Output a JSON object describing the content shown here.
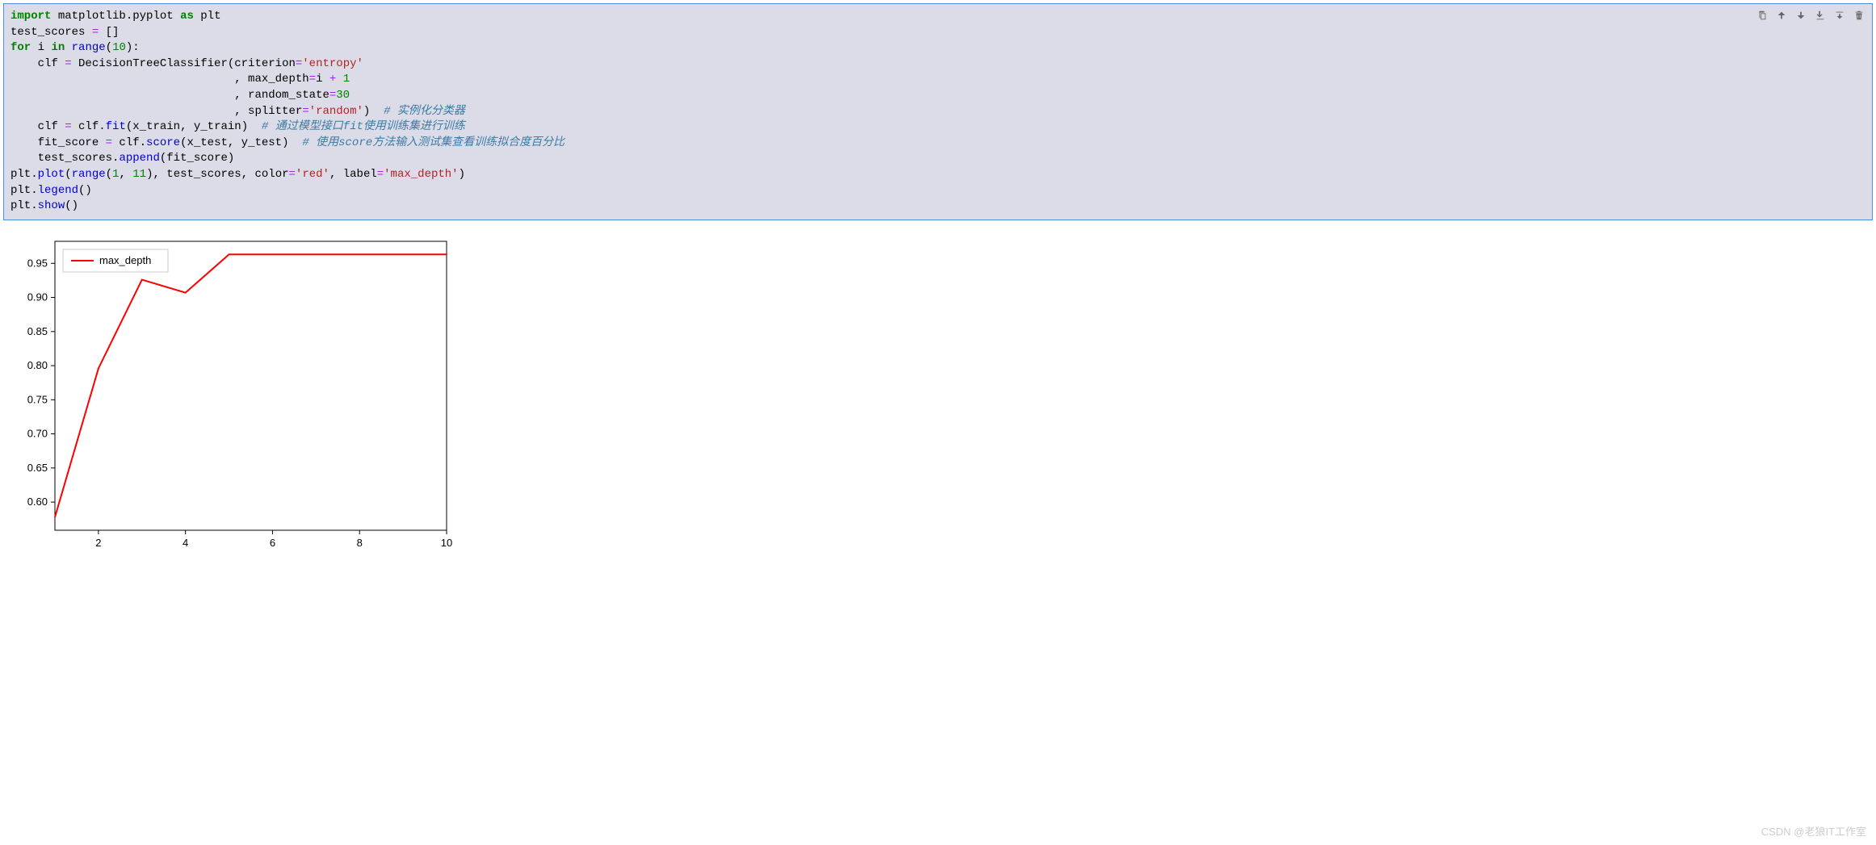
{
  "code_lines": [
    {
      "indent": 0,
      "tokens": [
        [
          "kw",
          "import"
        ],
        [
          "nm",
          " matplotlib.pyplot "
        ],
        [
          "kw",
          "as"
        ],
        [
          "nm",
          " plt"
        ]
      ]
    },
    {
      "indent": 0,
      "tokens": [
        [
          "nm",
          "test_scores "
        ],
        [
          "op",
          "="
        ],
        [
          "nm",
          " []"
        ]
      ]
    },
    {
      "indent": 0,
      "tokens": [
        [
          "kw",
          "for"
        ],
        [
          "nm",
          " i "
        ],
        [
          "kw",
          "in"
        ],
        [
          "nm",
          " "
        ],
        [
          "fn",
          "range"
        ],
        [
          "paren",
          "("
        ],
        [
          "num",
          "10"
        ],
        [
          "paren",
          ")"
        ],
        [
          "nm",
          ":"
        ]
      ]
    },
    {
      "indent": 1,
      "tokens": [
        [
          "nm",
          "clf "
        ],
        [
          "op",
          "="
        ],
        [
          "nm",
          " DecisionTreeClassifier(criterion"
        ],
        [
          "op",
          "="
        ],
        [
          "str",
          "'entropy'"
        ]
      ]
    },
    {
      "indent": 0,
      "tokens": [
        [
          "nm",
          "                                 , max_depth"
        ],
        [
          "op",
          "="
        ],
        [
          "nm",
          "i "
        ],
        [
          "op",
          "+"
        ],
        [
          "nm",
          " "
        ],
        [
          "num",
          "1"
        ]
      ]
    },
    {
      "indent": 0,
      "tokens": [
        [
          "nm",
          "                                 , random_state"
        ],
        [
          "op",
          "="
        ],
        [
          "num",
          "30"
        ]
      ]
    },
    {
      "indent": 0,
      "tokens": [
        [
          "nm",
          "                                 , splitter"
        ],
        [
          "op",
          "="
        ],
        [
          "str",
          "'random'"
        ],
        [
          "paren",
          ")"
        ],
        [
          "nm",
          "  "
        ],
        [
          "comment",
          "# 实例化分类器"
        ]
      ]
    },
    {
      "indent": 1,
      "tokens": [
        [
          "nm",
          "clf "
        ],
        [
          "op",
          "="
        ],
        [
          "nm",
          " clf."
        ],
        [
          "fn",
          "fit"
        ],
        [
          "paren",
          "("
        ],
        [
          "nm",
          "x_train, y_train"
        ],
        [
          "paren",
          ")"
        ],
        [
          "nm",
          "  "
        ],
        [
          "comment",
          "# 通过模型接口fit使用训练集进行训练"
        ]
      ]
    },
    {
      "indent": 1,
      "tokens": [
        [
          "nm",
          "fit_score "
        ],
        [
          "op",
          "="
        ],
        [
          "nm",
          " clf."
        ],
        [
          "fn",
          "score"
        ],
        [
          "paren",
          "("
        ],
        [
          "nm",
          "x_test, y_test"
        ],
        [
          "paren",
          ")"
        ],
        [
          "nm",
          "  "
        ],
        [
          "comment",
          "# 使用score方法输入测试集查看训练拟合度百分比"
        ]
      ]
    },
    {
      "indent": 1,
      "tokens": [
        [
          "nm",
          "test_scores."
        ],
        [
          "fn",
          "append"
        ],
        [
          "paren",
          "("
        ],
        [
          "nm",
          "fit_score"
        ],
        [
          "paren",
          ")"
        ]
      ]
    },
    {
      "indent": 0,
      "tokens": [
        [
          "nm",
          ""
        ]
      ]
    },
    {
      "indent": 0,
      "tokens": [
        [
          "nm",
          "plt."
        ],
        [
          "fn",
          "plot"
        ],
        [
          "paren",
          "("
        ],
        [
          "fn",
          "range"
        ],
        [
          "paren",
          "("
        ],
        [
          "num",
          "1"
        ],
        [
          "nm",
          ", "
        ],
        [
          "num",
          "11"
        ],
        [
          "paren",
          ")"
        ],
        [
          "nm",
          ", test_scores, color"
        ],
        [
          "op",
          "="
        ],
        [
          "str",
          "'red'"
        ],
        [
          "nm",
          ", label"
        ],
        [
          "op",
          "="
        ],
        [
          "str",
          "'max_depth'"
        ],
        [
          "paren",
          ")"
        ]
      ]
    },
    {
      "indent": 0,
      "tokens": [
        [
          "nm",
          "plt."
        ],
        [
          "fn",
          "legend"
        ],
        [
          "paren",
          "()"
        ]
      ]
    },
    {
      "indent": 0,
      "tokens": [
        [
          "nm",
          "plt."
        ],
        [
          "fn",
          "show"
        ],
        [
          "paren",
          "()"
        ]
      ]
    }
  ],
  "chart_data": {
    "type": "line",
    "x": [
      1,
      2,
      3,
      4,
      5,
      6,
      7,
      8,
      9,
      10
    ],
    "values": [
      0.578,
      0.796,
      0.926,
      0.907,
      0.963,
      0.963,
      0.963,
      0.963,
      0.963,
      0.963
    ],
    "series_name": "max_depth",
    "color": "red",
    "xlabel": "",
    "ylabel": "",
    "title": "",
    "xlim": [
      1,
      10
    ],
    "ylim": [
      0.578,
      0.963
    ],
    "yticks": [
      0.6,
      0.65,
      0.7,
      0.75,
      0.8,
      0.85,
      0.9,
      0.95
    ],
    "xticks": [
      2,
      4,
      6,
      8,
      10
    ],
    "legend_position": "upper-left"
  },
  "watermark": "CSDN @老狼IT工作室"
}
